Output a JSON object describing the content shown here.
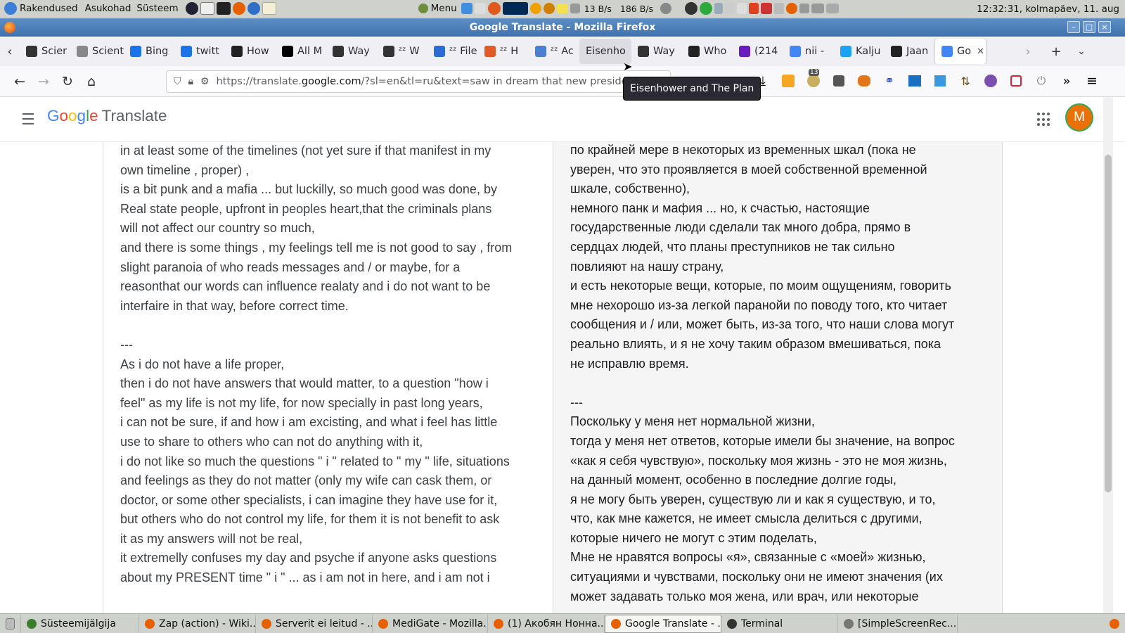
{
  "system_panel": {
    "menus": [
      "Rakendused",
      "Asukohad",
      "Süsteem"
    ],
    "menu_label": "Menu",
    "net_down": "13 B/s",
    "net_up": "186 B/s",
    "clock": "12:32:31, kolmapäev, 11. aug"
  },
  "window": {
    "title": "Google Translate - Mozilla Firefox"
  },
  "tabs": [
    {
      "label": "Scier",
      "color": "#333333"
    },
    {
      "label": "Sciento",
      "color": "#888888"
    },
    {
      "label": "Bing",
      "color": "#1a73e8"
    },
    {
      "label": "twitt",
      "color": "#1a73e8"
    },
    {
      "label": "How",
      "color": "#222222"
    },
    {
      "label": "All M",
      "color": "#000000"
    },
    {
      "label": "Way",
      "color": "#333333"
    },
    {
      "label": "ᶻᶻ W",
      "color": "#333333"
    },
    {
      "label": "ᶻᶻ File N",
      "color": "#2b6cd4"
    },
    {
      "label": "ᶻᶻ H",
      "color": "#e05a2a"
    },
    {
      "label": "ᶻᶻ Ac",
      "color": "#4a7fd1"
    },
    {
      "label": "Eisenho",
      "color": "#dcdce1"
    },
    {
      "label": "Way",
      "color": "#333333"
    },
    {
      "label": "Who",
      "color": "#222222"
    },
    {
      "label": "(214",
      "color": "#6a1bbd"
    },
    {
      "label": "nii -",
      "color": "#4285f4"
    },
    {
      "label": "Kalju",
      "color": "#1da1f2"
    },
    {
      "label": "Jaan",
      "color": "#222222"
    },
    {
      "label": "Go",
      "color": "#4285f4"
    }
  ],
  "urlbar": {
    "url_prefix": "https://translate.",
    "url_host": "google.com",
    "url_rest": "/?sl=en&tl=ru&text=saw in dream that new preside"
  },
  "extensions": {
    "badge_count": "13"
  },
  "tooltip": "Eisenhower and The Plan",
  "gt": {
    "logo_product": "Translate",
    "avatar_letter": "M",
    "source_text": "in at least some of the timelines (not yet sure if that manifest in my\nown timeline , proper) ,\nis a bit punk and a mafia ... but luckilly, so much good was done, by\nReal state people, upfront in peoples heart,that the criminals plans\nwill not affect our country so much,\nand there is some things , my feelings tell me is not good to say , from\nslight paranoia of who reads messages and / or maybe, for a\nreasonthat our words can influence realaty and i do not want to be\ninterfaire in that way, before correct time.\n\n---\nAs i do not have a life proper,\nthen i do not have answers that would matter, to a question \"how i\nfeel\" as my life is not my life, for now specially in past long years,\ni can not be sure, if and how i am excisting, and what i feel has little\nuse to share to others who can not do anything with it,\ni do not like so much the questions \" i \" related to \" my \" life, situations\nand feelings as they do not matter (only my wife can cask them, or\ndoctor, or some other specialists, i can imagine they have use for it,\nbut others who do not control my life, for them it is not benefit to ask\nit as my answers will not be real,\nit extremelly confuses my day and psyche if anyone asks questions\nabout my PRESENT time \" i \" ... as i am not in here, and i am not i",
    "target_text": "по крайней мере в некоторых из временных шкал (пока не\nуверен, что это проявляется в моей собственной временной\nшкале, собственно),\nнемного панк и мафия ... но, к счастью, настоящие\nгосударственные люди сделали так много добра, прямо в\nсердцах людей, что планы преступников не так сильно\nповлияют на нашу страну,\nи есть некоторые вещи, которые, по моим ощущениям, говорить\nмне нехорошо из-за легкой паранойи по поводу того, кто читает\nсообщения и / или, может быть, из-за того, что наши слова могут\nреально влиять, и я не хочу таким образом вмешиваться, пока\nне исправлю время.\n\n---\nПоскольку у меня нет нормальной жизни,\nтогда у меня нет ответов, которые имели бы значение, на вопрос\n«как я себя чувствую», поскольку моя жизнь - это не моя жизнь,\nна данный момент, особенно в последние долгие годы,\nя не могу быть уверен, существую ли и как я существую, и то,\nчто, как мне кажется, не имеет смысла делиться с другими,\nкоторые ничего не могут с этим поделать,\nМне не нравятся вопросы «я», связанные с «моей» жизнью,\nситуациями и чувствами, поскольку они не имеют значения (их\nможет задавать только моя жена, или врач, или некоторые"
  },
  "taskbar": [
    {
      "label": "Süsteemijälgija",
      "color": "#3a7d2c"
    },
    {
      "label": "Zap (action) - Wiki...",
      "color": "#e66000"
    },
    {
      "label": "Serverit ei leitud - ...",
      "color": "#e66000"
    },
    {
      "label": "MediGate - Mozilla...",
      "color": "#e66000"
    },
    {
      "label": "(1) Акобян Нонна...",
      "color": "#e66000"
    },
    {
      "label": "Google Translate - ...",
      "color": "#e66000"
    },
    {
      "label": "Terminal",
      "color": "#333333"
    },
    {
      "label": "[SimpleScreenRec...",
      "color": "#777777"
    }
  ]
}
